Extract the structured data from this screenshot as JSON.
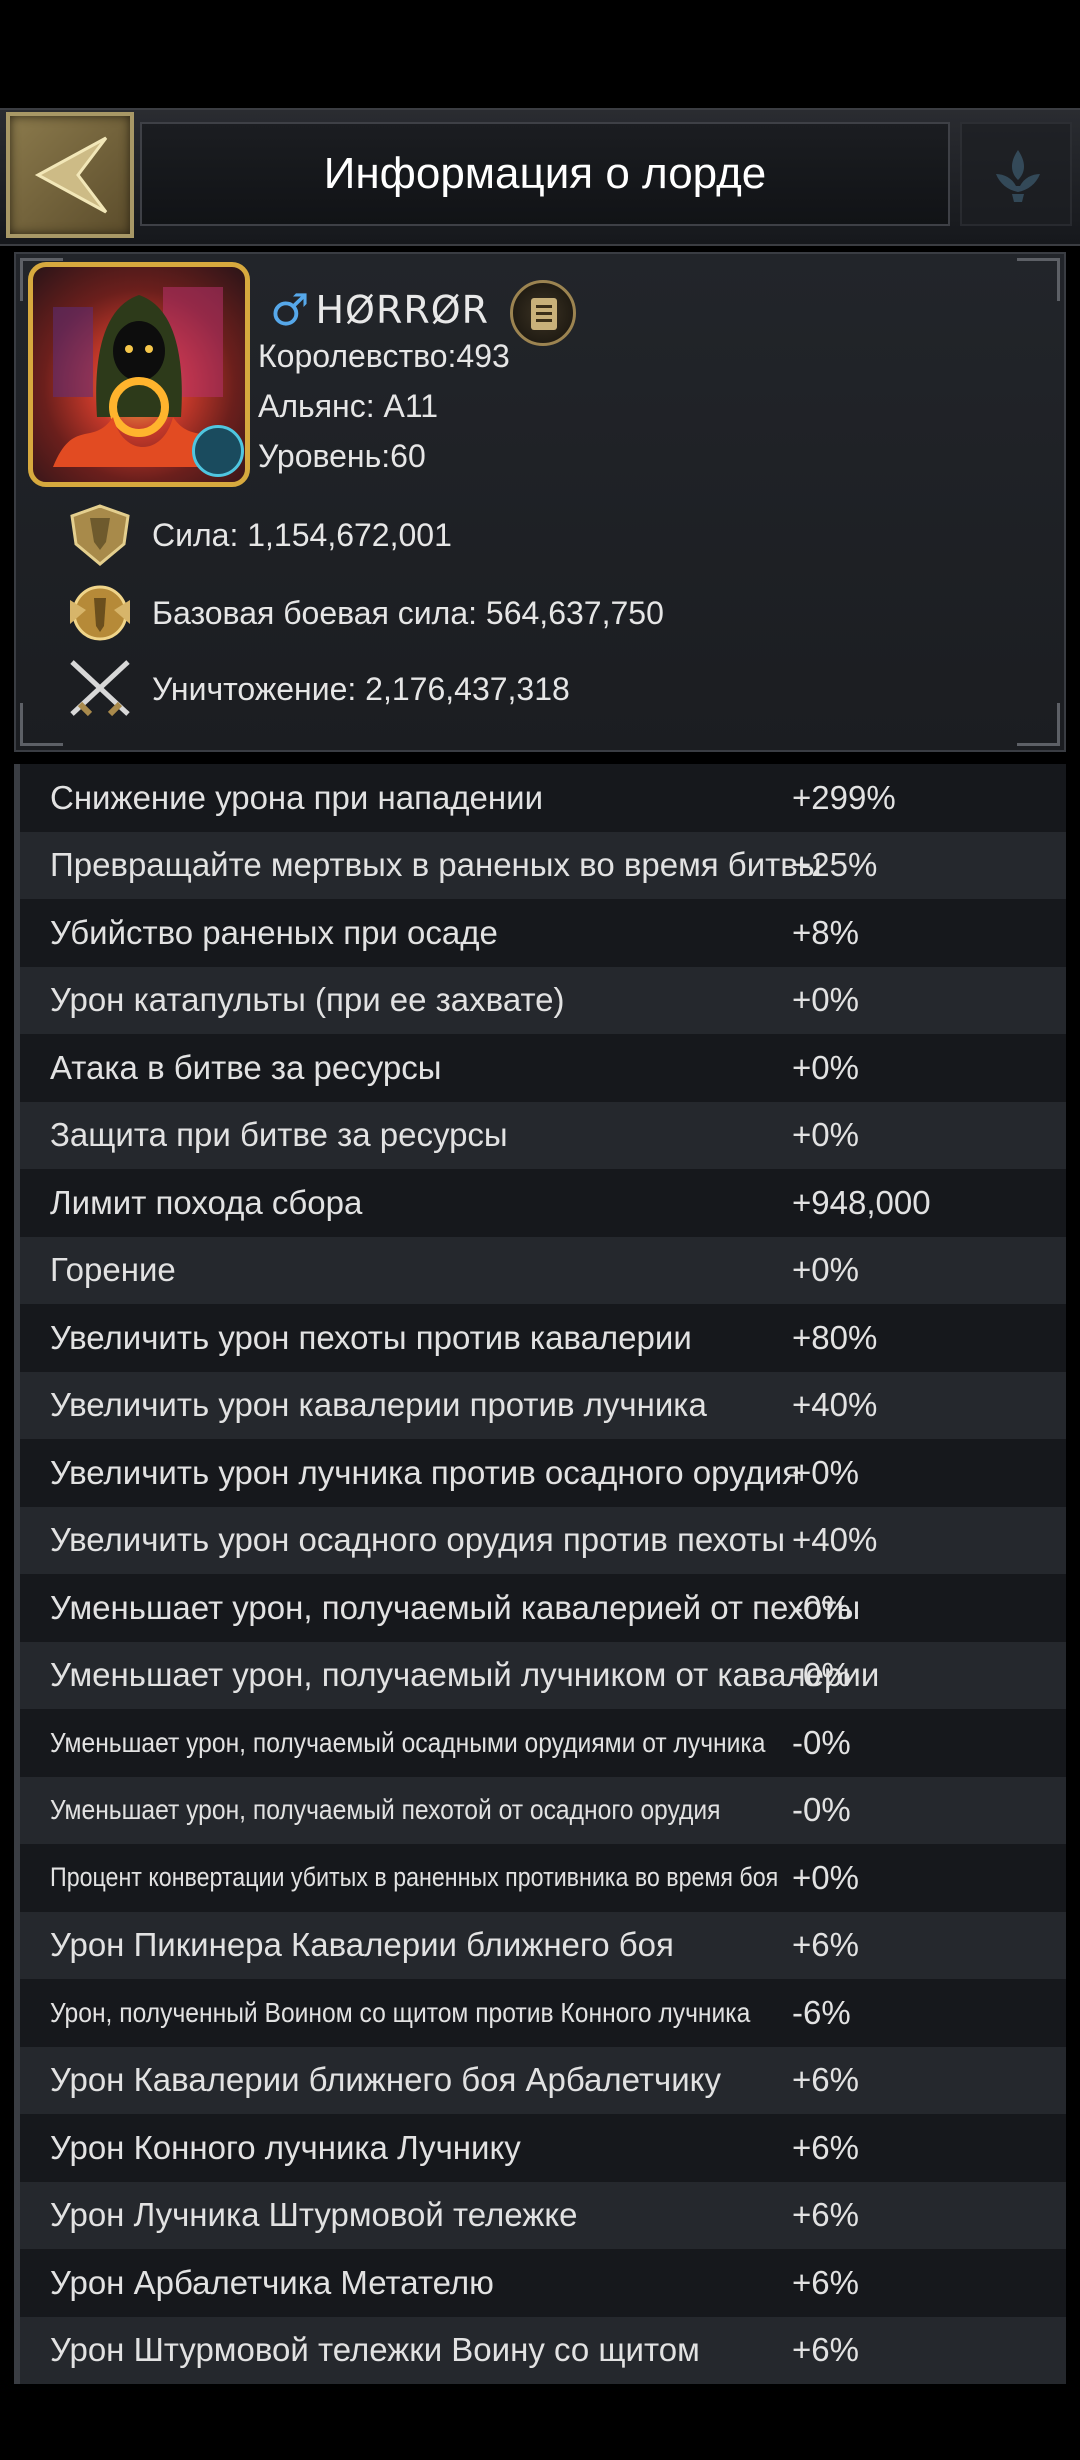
{
  "header": {
    "title": "Информация о лорде"
  },
  "profile": {
    "gender_icon": "male-icon",
    "name": "HØRRØR",
    "kingdom": "Королевство:493",
    "alliance": "Альянс: A11",
    "level": "Уровень:60"
  },
  "stats": {
    "power": "Сила: 1,154,672,001",
    "base_combat_power": "Базовая боевая сила: 564,637,750",
    "kills": "Уничтожение: 2,176,437,318"
  },
  "attributes": [
    {
      "label": "Снижение урона при нападении",
      "value": "+299%"
    },
    {
      "label": "Превращайте мертвых в раненых во время битвы",
      "value": "+25%"
    },
    {
      "label": "Убийство раненых при осаде",
      "value": "+8%"
    },
    {
      "label": "Урон катапульты (при ее захвате)",
      "value": "+0%"
    },
    {
      "label": "Атака в битве за ресурсы",
      "value": "+0%"
    },
    {
      "label": "Защита при битве за ресурсы",
      "value": "+0%"
    },
    {
      "label": "Лимит похода сбора",
      "value": "+948,000"
    },
    {
      "label": "Горение",
      "value": "+0%"
    },
    {
      "label": "Увеличить урон пехоты против кавалерии",
      "value": "+80%"
    },
    {
      "label": "Увеличить урон кавалерии против лучника",
      "value": "+40%"
    },
    {
      "label": "Увеличить урон лучника против осадного орудия",
      "value": "+0%"
    },
    {
      "label": "Увеличить урон осадного орудия против пехоты",
      "value": "+40%"
    },
    {
      "label": "Уменьшает урон, получаемый кавалерией от пехоты",
      "value": "-0%"
    },
    {
      "label": "Уменьшает урон, получаемый лучником от кавалерии",
      "value": "-0%"
    },
    {
      "label": "Уменьшает урон, получаемый осадными орудиями от лучника",
      "value": "-0%"
    },
    {
      "label": "Уменьшает урон, получаемый пехотой от осадного орудия",
      "value": "-0%"
    },
    {
      "label": "Процент конвертации убитых в раненных противника во время боя",
      "value": "+0%"
    },
    {
      "label": "Урон Пикинера Кавалерии ближнего боя",
      "value": "+6%"
    },
    {
      "label": "Урон, полученный Воином со щитом против Конного лучника",
      "value": "-6%"
    },
    {
      "label": "Урон Кавалерии ближнего боя Арбалетчику",
      "value": "+6%"
    },
    {
      "label": "Урон Конного лучника Лучнику",
      "value": "+6%"
    },
    {
      "label": "Урон Лучника Штурмовой тележке",
      "value": "+6%"
    },
    {
      "label": "Урон Арбалетчика Метателю",
      "value": "+6%"
    },
    {
      "label": "Урон Штурмовой тележки Воину со щитом",
      "value": "+6%"
    }
  ],
  "colors": {
    "accent_gold": "#d7a93e",
    "male_blue": "#56a8ea"
  }
}
